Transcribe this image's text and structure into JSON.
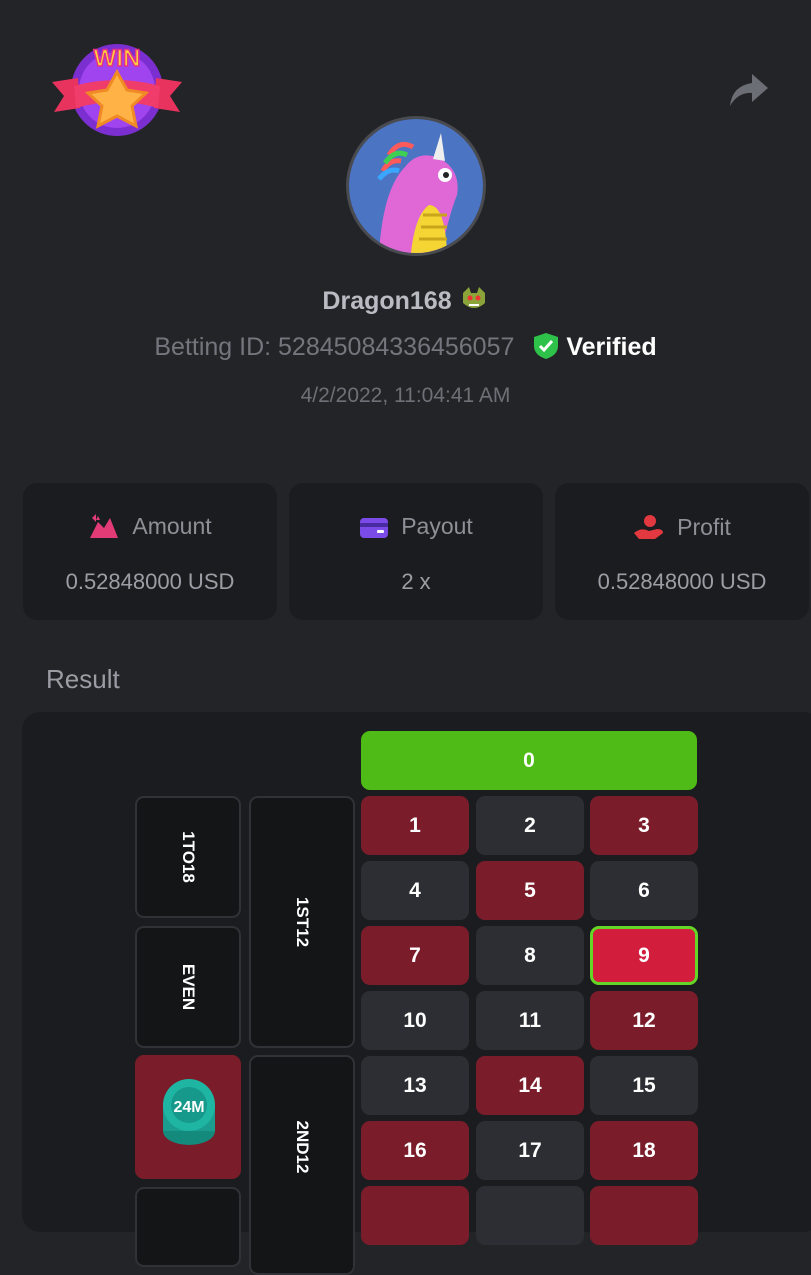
{
  "header": {
    "badge_text": "WIN",
    "badge_icon": "win-star-badge",
    "share_icon": "share-arrow-icon"
  },
  "player": {
    "username": "Dragon168",
    "betting_id_label": "Betting ID: 52845084336456057",
    "verified_label": "Verified",
    "datetime": "4/2/2022, 11:04:41 AM"
  },
  "stats": [
    {
      "label": "Amount",
      "value": "0.52848000 USD",
      "icon": "amount-icon",
      "color": "#e23b75"
    },
    {
      "label": "Payout",
      "value": "2 x",
      "icon": "payout-card-icon",
      "color": "#7b4be8"
    },
    {
      "label": "Profit",
      "value": "0.52848000 USD",
      "icon": "profit-hand-icon",
      "color": "#e2383f"
    }
  ],
  "result": {
    "title": "Result",
    "zero": "0",
    "numbers": [
      "1",
      "2",
      "3",
      "4",
      "5",
      "6",
      "7",
      "8",
      "9",
      "10",
      "11",
      "12",
      "13",
      "14",
      "15",
      "16",
      "17",
      "18"
    ],
    "red_numbers": [
      "1",
      "3",
      "5",
      "7",
      "9",
      "12",
      "14",
      "16",
      "18"
    ],
    "winning_number": "9",
    "side_bets": [
      "1TO18",
      "EVEN"
    ],
    "dozens": [
      "1ST12",
      "2ND12"
    ],
    "chip_label": "24M"
  },
  "colors": {
    "background": "#232427",
    "card": "#1b1c1f",
    "red_cell": "#7a1c2a",
    "dark_cell": "#2d2e33",
    "zero_green": "#4fbb16",
    "win_highlight": "#d21d3c",
    "win_border": "#63d627",
    "verified_shield": "#2fc24a",
    "chip": "#1fb5a3"
  }
}
